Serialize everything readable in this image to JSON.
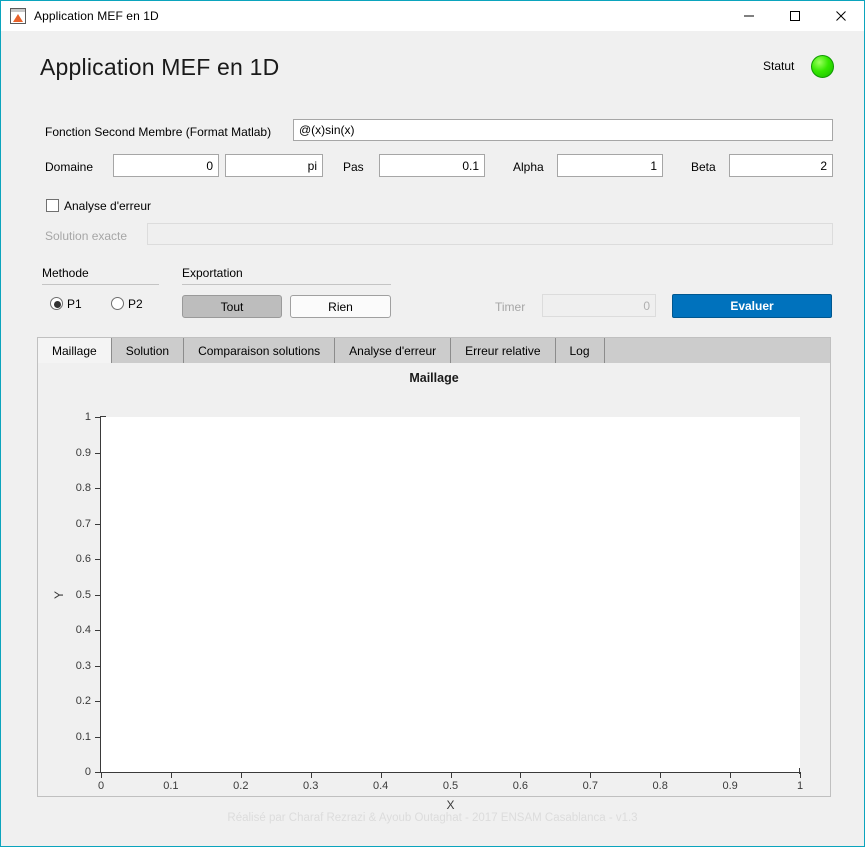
{
  "window": {
    "title": "Application MEF en 1D",
    "icon": "matlab-icon",
    "controls": {
      "minimize": "minimize-icon",
      "maximize": "maximize-icon",
      "close": "close-icon"
    }
  },
  "header": {
    "title": "Application MEF en 1D",
    "status_label": "Statut",
    "status_color": "#35e800"
  },
  "form": {
    "function_label": "Fonction Second Membre (Format Matlab)",
    "function_value": "@(x)sin(x)",
    "domain_label": "Domaine",
    "domain_start": "0",
    "domain_end": "pi",
    "step_label": "Pas",
    "step_value": "0.1",
    "alpha_label": "Alpha",
    "alpha_value": "1",
    "beta_label": "Beta",
    "beta_value": "2",
    "error_analysis_label": "Analyse d'erreur",
    "error_analysis_checked": false,
    "exact_solution_label": "Solution exacte",
    "exact_solution_value": "",
    "exact_solution_disabled": true
  },
  "method": {
    "group_label": "Methode",
    "options": [
      {
        "label": "P1",
        "selected": true
      },
      {
        "label": "P2",
        "selected": false
      }
    ]
  },
  "export": {
    "group_label": "Exportation",
    "all_label": "Tout",
    "none_label": "Rien",
    "all_pressed": true
  },
  "actions": {
    "timer_label": "Timer",
    "timer_value": "0",
    "timer_disabled": true,
    "evaluate_label": "Evaluer",
    "evaluate_color": "#0072bd"
  },
  "tabs": [
    {
      "label": "Maillage",
      "active": true
    },
    {
      "label": "Solution",
      "active": false
    },
    {
      "label": "Comparaison solutions",
      "active": false
    },
    {
      "label": "Analyse d'erreur",
      "active": false
    },
    {
      "label": "Erreur relative",
      "active": false
    },
    {
      "label": "Log",
      "active": false
    }
  ],
  "chart_data": {
    "type": "line",
    "title": "Maillage",
    "xlabel": "X",
    "ylabel": "Y",
    "xlim": [
      0,
      1
    ],
    "ylim": [
      0,
      1
    ],
    "xticks": [
      0,
      0.1,
      0.2,
      0.3,
      0.4,
      0.5,
      0.6,
      0.7,
      0.8,
      0.9,
      1
    ],
    "yticks": [
      0,
      0.1,
      0.2,
      0.3,
      0.4,
      0.5,
      0.6,
      0.7,
      0.8,
      0.9,
      1
    ],
    "xticklabels": [
      "0",
      "0.1",
      "0.2",
      "0.3",
      "0.4",
      "0.5",
      "0.6",
      "0.7",
      "0.8",
      "0.9",
      "1"
    ],
    "yticklabels": [
      "0",
      "0.1",
      "0.2",
      "0.3",
      "0.4",
      "0.5",
      "0.6",
      "0.7",
      "0.8",
      "0.9",
      "1"
    ],
    "grid": false,
    "legend": null,
    "series": [],
    "note": "Empty axes - no data plotted yet"
  },
  "footer": {
    "text": "Réalisé par Charaf Rezrazi & Ayoub Outaghat - 2017 ENSAM Casablanca - v1.3"
  }
}
